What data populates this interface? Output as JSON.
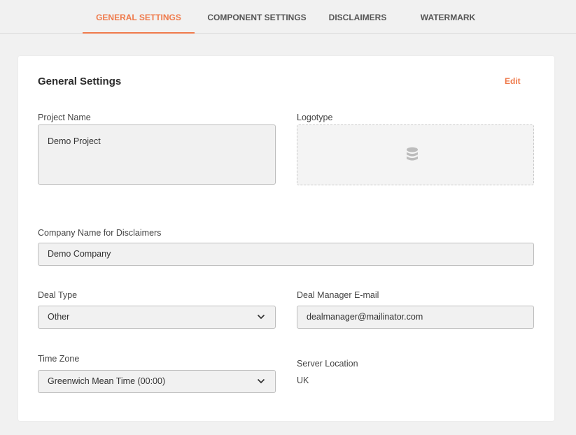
{
  "tabs": [
    {
      "label": "GENERAL SETTINGS",
      "active": true
    },
    {
      "label": "COMPONENT SETTINGS",
      "active": false
    },
    {
      "label": "DISCLAIMERS",
      "active": false
    },
    {
      "label": "WATERMARK",
      "active": false
    }
  ],
  "colors": {
    "accent": "#ef7a4b",
    "background": "#f1f1f1",
    "card": "#ffffff",
    "field_bg": "#f1f1f1",
    "field_border": "#bdbdbd"
  },
  "card": {
    "title": "General Settings",
    "edit_label": "Edit"
  },
  "fields": {
    "project_name": {
      "label": "Project Name",
      "value": "Demo Project"
    },
    "logotype": {
      "label": "Logotype",
      "icon": "database-icon"
    },
    "company_name": {
      "label": "Company Name for Disclaimers",
      "value": "Demo Company"
    },
    "deal_type": {
      "label": "Deal Type",
      "value": "Other",
      "icon": "chevron-down-icon"
    },
    "deal_manager_email": {
      "label": "Deal Manager E-mail",
      "value": "dealmanager@mailinator.com"
    },
    "time_zone": {
      "label": "Time Zone",
      "value": "Greenwich Mean Time (00:00)",
      "icon": "chevron-down-icon"
    },
    "server_location": {
      "label": "Server Location",
      "value": "UK"
    }
  }
}
